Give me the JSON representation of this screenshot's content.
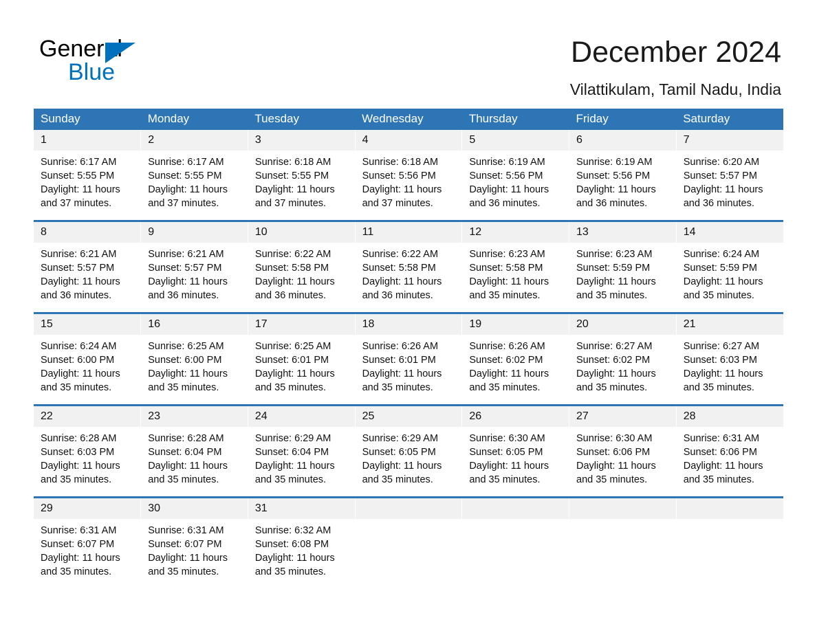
{
  "brand": {
    "line1": "General",
    "line2": "Blue",
    "triangle_color": "#0071BC"
  },
  "header": {
    "title": "December 2024",
    "subtitle": "Vilattikulam, Tamil Nadu, India",
    "accent_color": "#2E75B6",
    "daynum_bg": "#F1F1F1"
  },
  "weekdays": [
    "Sunday",
    "Monday",
    "Tuesday",
    "Wednesday",
    "Thursday",
    "Friday",
    "Saturday"
  ],
  "weeks": [
    [
      {
        "day": "1",
        "sunrise": "Sunrise: 6:17 AM",
        "sunset": "Sunset: 5:55 PM",
        "daylight1": "Daylight: 11 hours",
        "daylight2": "and 37 minutes."
      },
      {
        "day": "2",
        "sunrise": "Sunrise: 6:17 AM",
        "sunset": "Sunset: 5:55 PM",
        "daylight1": "Daylight: 11 hours",
        "daylight2": "and 37 minutes."
      },
      {
        "day": "3",
        "sunrise": "Sunrise: 6:18 AM",
        "sunset": "Sunset: 5:55 PM",
        "daylight1": "Daylight: 11 hours",
        "daylight2": "and 37 minutes."
      },
      {
        "day": "4",
        "sunrise": "Sunrise: 6:18 AM",
        "sunset": "Sunset: 5:56 PM",
        "daylight1": "Daylight: 11 hours",
        "daylight2": "and 37 minutes."
      },
      {
        "day": "5",
        "sunrise": "Sunrise: 6:19 AM",
        "sunset": "Sunset: 5:56 PM",
        "daylight1": "Daylight: 11 hours",
        "daylight2": "and 36 minutes."
      },
      {
        "day": "6",
        "sunrise": "Sunrise: 6:19 AM",
        "sunset": "Sunset: 5:56 PM",
        "daylight1": "Daylight: 11 hours",
        "daylight2": "and 36 minutes."
      },
      {
        "day": "7",
        "sunrise": "Sunrise: 6:20 AM",
        "sunset": "Sunset: 5:57 PM",
        "daylight1": "Daylight: 11 hours",
        "daylight2": "and 36 minutes."
      }
    ],
    [
      {
        "day": "8",
        "sunrise": "Sunrise: 6:21 AM",
        "sunset": "Sunset: 5:57 PM",
        "daylight1": "Daylight: 11 hours",
        "daylight2": "and 36 minutes."
      },
      {
        "day": "9",
        "sunrise": "Sunrise: 6:21 AM",
        "sunset": "Sunset: 5:57 PM",
        "daylight1": "Daylight: 11 hours",
        "daylight2": "and 36 minutes."
      },
      {
        "day": "10",
        "sunrise": "Sunrise: 6:22 AM",
        "sunset": "Sunset: 5:58 PM",
        "daylight1": "Daylight: 11 hours",
        "daylight2": "and 36 minutes."
      },
      {
        "day": "11",
        "sunrise": "Sunrise: 6:22 AM",
        "sunset": "Sunset: 5:58 PM",
        "daylight1": "Daylight: 11 hours",
        "daylight2": "and 36 minutes."
      },
      {
        "day": "12",
        "sunrise": "Sunrise: 6:23 AM",
        "sunset": "Sunset: 5:58 PM",
        "daylight1": "Daylight: 11 hours",
        "daylight2": "and 35 minutes."
      },
      {
        "day": "13",
        "sunrise": "Sunrise: 6:23 AM",
        "sunset": "Sunset: 5:59 PM",
        "daylight1": "Daylight: 11 hours",
        "daylight2": "and 35 minutes."
      },
      {
        "day": "14",
        "sunrise": "Sunrise: 6:24 AM",
        "sunset": "Sunset: 5:59 PM",
        "daylight1": "Daylight: 11 hours",
        "daylight2": "and 35 minutes."
      }
    ],
    [
      {
        "day": "15",
        "sunrise": "Sunrise: 6:24 AM",
        "sunset": "Sunset: 6:00 PM",
        "daylight1": "Daylight: 11 hours",
        "daylight2": "and 35 minutes."
      },
      {
        "day": "16",
        "sunrise": "Sunrise: 6:25 AM",
        "sunset": "Sunset: 6:00 PM",
        "daylight1": "Daylight: 11 hours",
        "daylight2": "and 35 minutes."
      },
      {
        "day": "17",
        "sunrise": "Sunrise: 6:25 AM",
        "sunset": "Sunset: 6:01 PM",
        "daylight1": "Daylight: 11 hours",
        "daylight2": "and 35 minutes."
      },
      {
        "day": "18",
        "sunrise": "Sunrise: 6:26 AM",
        "sunset": "Sunset: 6:01 PM",
        "daylight1": "Daylight: 11 hours",
        "daylight2": "and 35 minutes."
      },
      {
        "day": "19",
        "sunrise": "Sunrise: 6:26 AM",
        "sunset": "Sunset: 6:02 PM",
        "daylight1": "Daylight: 11 hours",
        "daylight2": "and 35 minutes."
      },
      {
        "day": "20",
        "sunrise": "Sunrise: 6:27 AM",
        "sunset": "Sunset: 6:02 PM",
        "daylight1": "Daylight: 11 hours",
        "daylight2": "and 35 minutes."
      },
      {
        "day": "21",
        "sunrise": "Sunrise: 6:27 AM",
        "sunset": "Sunset: 6:03 PM",
        "daylight1": "Daylight: 11 hours",
        "daylight2": "and 35 minutes."
      }
    ],
    [
      {
        "day": "22",
        "sunrise": "Sunrise: 6:28 AM",
        "sunset": "Sunset: 6:03 PM",
        "daylight1": "Daylight: 11 hours",
        "daylight2": "and 35 minutes."
      },
      {
        "day": "23",
        "sunrise": "Sunrise: 6:28 AM",
        "sunset": "Sunset: 6:04 PM",
        "daylight1": "Daylight: 11 hours",
        "daylight2": "and 35 minutes."
      },
      {
        "day": "24",
        "sunrise": "Sunrise: 6:29 AM",
        "sunset": "Sunset: 6:04 PM",
        "daylight1": "Daylight: 11 hours",
        "daylight2": "and 35 minutes."
      },
      {
        "day": "25",
        "sunrise": "Sunrise: 6:29 AM",
        "sunset": "Sunset: 6:05 PM",
        "daylight1": "Daylight: 11 hours",
        "daylight2": "and 35 minutes."
      },
      {
        "day": "26",
        "sunrise": "Sunrise: 6:30 AM",
        "sunset": "Sunset: 6:05 PM",
        "daylight1": "Daylight: 11 hours",
        "daylight2": "and 35 minutes."
      },
      {
        "day": "27",
        "sunrise": "Sunrise: 6:30 AM",
        "sunset": "Sunset: 6:06 PM",
        "daylight1": "Daylight: 11 hours",
        "daylight2": "and 35 minutes."
      },
      {
        "day": "28",
        "sunrise": "Sunrise: 6:31 AM",
        "sunset": "Sunset: 6:06 PM",
        "daylight1": "Daylight: 11 hours",
        "daylight2": "and 35 minutes."
      }
    ],
    [
      {
        "day": "29",
        "sunrise": "Sunrise: 6:31 AM",
        "sunset": "Sunset: 6:07 PM",
        "daylight1": "Daylight: 11 hours",
        "daylight2": "and 35 minutes."
      },
      {
        "day": "30",
        "sunrise": "Sunrise: 6:31 AM",
        "sunset": "Sunset: 6:07 PM",
        "daylight1": "Daylight: 11 hours",
        "daylight2": "and 35 minutes."
      },
      {
        "day": "31",
        "sunrise": "Sunrise: 6:32 AM",
        "sunset": "Sunset: 6:08 PM",
        "daylight1": "Daylight: 11 hours",
        "daylight2": "and 35 minutes."
      },
      {
        "day": "",
        "sunrise": "",
        "sunset": "",
        "daylight1": "",
        "daylight2": ""
      },
      {
        "day": "",
        "sunrise": "",
        "sunset": "",
        "daylight1": "",
        "daylight2": ""
      },
      {
        "day": "",
        "sunrise": "",
        "sunset": "",
        "daylight1": "",
        "daylight2": ""
      },
      {
        "day": "",
        "sunrise": "",
        "sunset": "",
        "daylight1": "",
        "daylight2": ""
      }
    ]
  ]
}
